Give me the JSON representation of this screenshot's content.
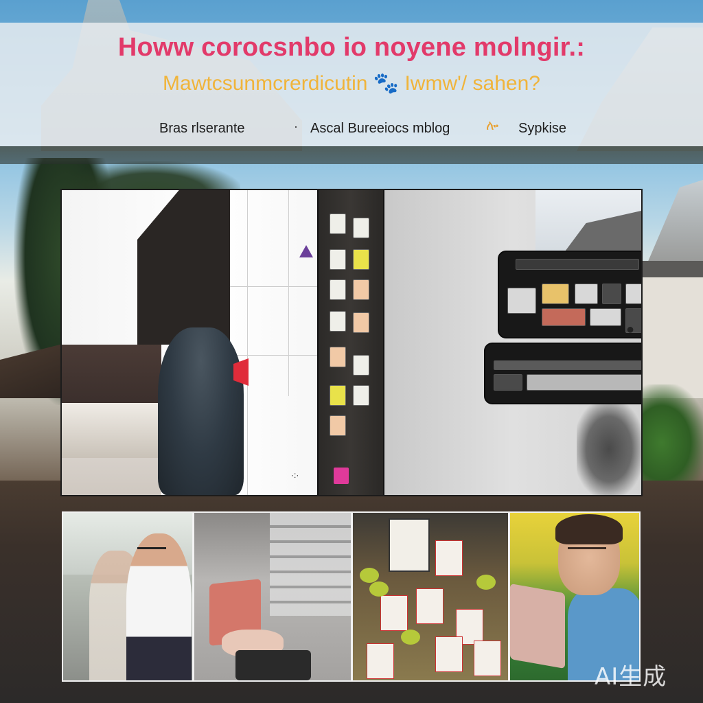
{
  "header": {
    "headline": "Howw corocsnbo io noyene molngir.:",
    "subheadline": "Mawtcsunmcrerdicutin 🐾 Iwmw'/ sahen?",
    "nav": {
      "left": "Bras rlserante",
      "dot": "·",
      "middle": "Ascal Bureeiocs mblog",
      "sparkle": "ሎ",
      "right": "Sypkise"
    }
  },
  "collage": {
    "dots_left": "·:·",
    "dots_right": "●"
  },
  "photos": [
    {
      "icon": "people-reading-icon"
    },
    {
      "icon": "laptop-hands-icon"
    },
    {
      "icon": "flyers-stall-icon"
    },
    {
      "icon": "man-laptop-icon"
    }
  ],
  "watermark": "AI生成",
  "colors": {
    "headline": "#e23a6a",
    "subheadline": "#f0b43a",
    "nav_text": "#1e1e1e",
    "banner": "#eceef0"
  }
}
